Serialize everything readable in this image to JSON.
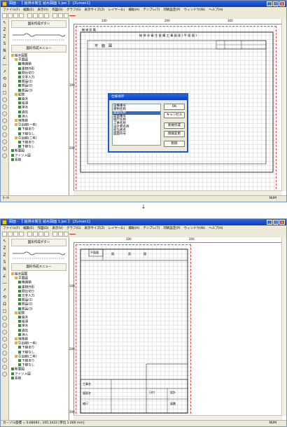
{
  "arrow_glyph": "↓",
  "top": {
    "title": "図面 - 【 給排水衛生 給水図面 1.jwc 】 [Zumen1]",
    "menu": [
      "ファイル(F)",
      "編集(E)",
      "表示(V)",
      "作図(D)",
      "グラフ(G)",
      "表示サイズ(Z)",
      "レイヤー(L)",
      "補助(H)",
      "テンプレ(T)",
      "印刷設定(P)",
      "ウィンドウ(W)",
      "ヘルプ(H)"
    ],
    "toolbar_icons": [
      "new-icon",
      "open-icon",
      "save-icon",
      "print-icon",
      "cut-icon",
      "copy-icon",
      "paste-icon",
      "undo-icon",
      "zoom-icon",
      "grid-icon",
      "text-icon",
      "line-icon"
    ],
    "left_tools": [
      "↖",
      "Z",
      "Z",
      "S",
      "N",
      "∠",
      "―",
      "↗",
      "⟲",
      "Ω",
      "□",
      "◯",
      "◯",
      "◯",
      "◯",
      "◯",
      "◯",
      "◯",
      "◯",
      "◯"
    ],
    "panel": {
      "header": "図形作成ボタン",
      "section": "図形作成メニュー",
      "tree": [
        {
          "label": "給水図面",
          "level": 0,
          "folder": true
        },
        {
          "label": "平面図",
          "level": 1,
          "folder": true
        },
        {
          "label": "機器類",
          "level": 2
        },
        {
          "label": "建物外形",
          "level": 2
        },
        {
          "label": "間仕切り",
          "level": 2
        },
        {
          "label": "文字入力",
          "level": 2
        },
        {
          "label": "部品(1)",
          "level": 2
        },
        {
          "label": "部品(2)",
          "level": 2
        },
        {
          "label": "部品(3)",
          "level": 2
        },
        {
          "label": "配管",
          "level": 1,
          "folder": true
        },
        {
          "label": "給水",
          "level": 2
        },
        {
          "label": "給湯",
          "level": 2
        },
        {
          "label": "排水",
          "level": 2
        },
        {
          "label": "通気",
          "level": 2
        },
        {
          "label": "消火",
          "level": 2
        },
        {
          "label": "特殊線",
          "level": 1,
          "folder": true
        },
        {
          "label": "引出線(一本)",
          "level": 1,
          "folder": true
        },
        {
          "label": "下線あり",
          "level": 2
        },
        {
          "label": "下線なし",
          "level": 2
        },
        {
          "label": "引出線(二本)",
          "level": 1,
          "folder": true
        },
        {
          "label": "下線あり",
          "level": 2
        },
        {
          "label": "下線なし",
          "level": 2
        },
        {
          "label": "断面図",
          "level": 0
        },
        {
          "label": "アイソメ図",
          "level": 0
        },
        {
          "label": "系統",
          "level": 0
        }
      ]
    },
    "ruler_h": [
      "100",
      "200",
      "300"
    ],
    "ruler_v": [
      "100",
      "200"
    ],
    "sheet_title": "給 排 水 衛 生 設 備 工 事 図 面 ( 平 面 図 )",
    "sheet_label": "平　面　図",
    "stamp": "機 械 設 備",
    "dialog": {
      "title": "仕様保存",
      "items": [
        "設備番号",
        "建物名称",
        "図面名称",
        "図面番号",
        "縮尺名称",
        "工事名称",
        "設計者名称",
        "担当者名",
        "図面符号"
      ],
      "selected_index": 2,
      "buttons": [
        "OK",
        "キャンセル",
        "新規作成",
        "情報変更",
        "削除"
      ]
    },
    "status_left": "ｶｰｿﾙ",
    "status_num": "NUM"
  },
  "bottom": {
    "title": "図面 - 【 給排水衛生 給水図面 1.jwc 】 [Zumen1]",
    "menu": [
      "ファイル(F)",
      "編集(E)",
      "作図(D)",
      "表示(V)",
      "グラフ(G)",
      "表示サイズ(Z)",
      "レイヤー(L)",
      "補助(H)",
      "テンプレ(T)",
      "印刷設定(P)",
      "ウィンドウ(W)",
      "ヘルプ(H)"
    ],
    "toolbar_icons": [
      "new-icon",
      "open-icon",
      "save-icon",
      "print-icon",
      "cut-icon",
      "copy-icon",
      "paste-icon",
      "undo-icon",
      "zoom-icon",
      "grid-icon",
      "text-icon",
      "line-icon"
    ],
    "left_tools": [
      "↖",
      "Z",
      "Z",
      "S",
      "N",
      "∠",
      "―",
      "↗",
      "⟲",
      "Ω",
      "□",
      "◯",
      "◯",
      "◯",
      "◯",
      "◯",
      "◯",
      "◯",
      "◯",
      "◯"
    ],
    "panel": {
      "header": "図形作成ボタン",
      "section": "図形作成メニュー",
      "tree": [
        {
          "label": "給水図面",
          "level": 0,
          "folder": true
        },
        {
          "label": "平面図",
          "level": 1,
          "folder": true
        },
        {
          "label": "機器類",
          "level": 2
        },
        {
          "label": "建物外形",
          "level": 2
        },
        {
          "label": "間仕切り",
          "level": 2
        },
        {
          "label": "文字入力",
          "level": 2
        },
        {
          "label": "部品(1)",
          "level": 2
        },
        {
          "label": "部品(2)",
          "level": 2
        },
        {
          "label": "部品(3)",
          "level": 2
        },
        {
          "label": "配管",
          "level": 1,
          "folder": true
        },
        {
          "label": "給水",
          "level": 2
        },
        {
          "label": "給湯",
          "level": 2
        },
        {
          "label": "排水",
          "level": 2
        },
        {
          "label": "通気",
          "level": 2
        },
        {
          "label": "消火",
          "level": 2
        },
        {
          "label": "特殊線",
          "level": 1,
          "folder": true
        },
        {
          "label": "引出線(一本)",
          "level": 1,
          "folder": true
        },
        {
          "label": "下線あり",
          "level": 2
        },
        {
          "label": "下線なし",
          "level": 2
        },
        {
          "label": "引出線(二本)",
          "level": 1,
          "folder": true
        },
        {
          "label": "下線あり",
          "level": 2
        },
        {
          "label": "下線なし",
          "level": 2
        },
        {
          "label": "断面図",
          "level": 0
        },
        {
          "label": "アイソメ図",
          "level": 0
        },
        {
          "label": "系統",
          "level": 0
        }
      ]
    },
    "ruler_h": [
      "100",
      "200"
    ],
    "ruler_v": [
      "100",
      "200",
      "300"
    ],
    "sheet_header": [
      "平面図",
      "図",
      "面",
      "図"
    ],
    "title_block": [
      "工事名",
      "図面名",
      "縮尺",
      "日付",
      "設計",
      "図番"
    ],
    "status_left": "カーソル座標 = 0.68093 , 105.3433 [単位 1.000 mm]",
    "status_num": "NUM"
  },
  "colors": {
    "title_bar": "#0a3fb8",
    "sheet_border": "#e45050",
    "selection": "#316ac5"
  }
}
